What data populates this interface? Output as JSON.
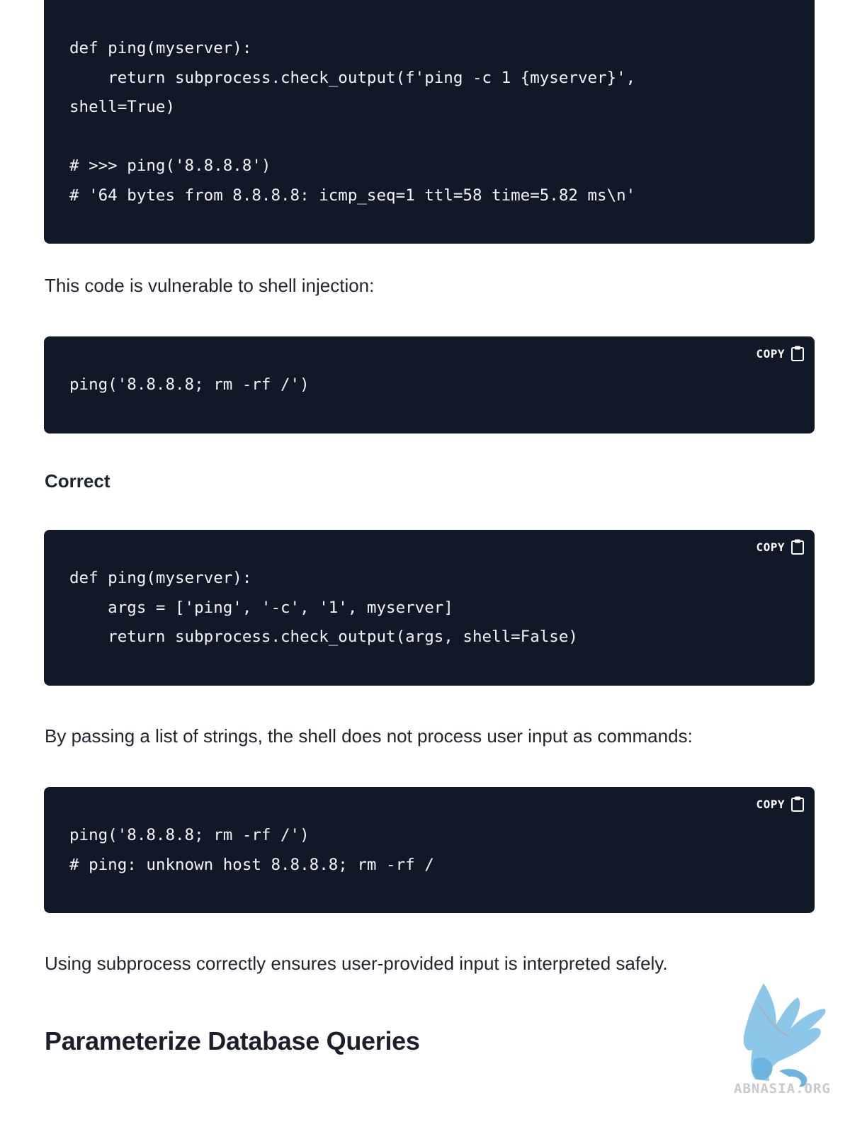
{
  "blocks": {
    "code1": {
      "lines": [
        "def ping(myserver):",
        "    return subprocess.check_output(f'ping -c 1 {myserver}',",
        "shell=True)",
        "",
        "# >>> ping('8.8.8.8')",
        "# '64 bytes from 8.8.8.8: icmp_seq=1 ttl=58 time=5.82 ms\\n'"
      ]
    },
    "para1": "This code is vulnerable to shell injection:",
    "code2": {
      "copy_label": "COPY",
      "lines": [
        "ping('8.8.8.8; rm -rf /')"
      ]
    },
    "correct_heading": "Correct",
    "code3": {
      "copy_label": "COPY",
      "lines": [
        "def ping(myserver):",
        "    args = ['ping', '-c', '1', myserver]",
        "    return subprocess.check_output(args, shell=False)"
      ]
    },
    "para2": "By passing a list of strings, the shell does not process user input as commands:",
    "code4": {
      "copy_label": "COPY",
      "lines": [
        "ping('8.8.8.8; rm -rf /')",
        "# ping: unknown host 8.8.8.8; rm -rf /"
      ]
    },
    "para3": "Using subprocess correctly ensures user-provided input is interpreted safely.",
    "section_heading": "Parameterize Database Queries"
  },
  "watermark": {
    "text": "ABNASIA.ORG",
    "icon": "griffin-logo-icon"
  },
  "colors": {
    "code_background": "#111827",
    "code_text": "#f3f4f6",
    "body_text": "#1f2430",
    "watermark_blue": "#7fc1e8"
  }
}
